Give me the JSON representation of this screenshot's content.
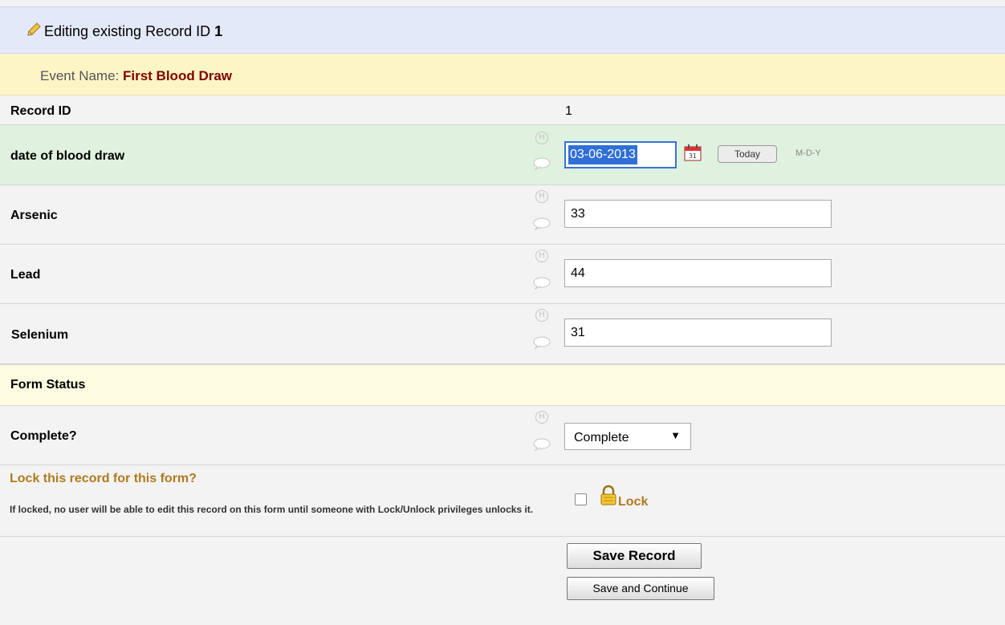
{
  "header": {
    "prefix": "Editing existing Record ID",
    "record_id": "1"
  },
  "event": {
    "label": "Event Name:",
    "value": "First Blood Draw"
  },
  "rows": {
    "record_id": {
      "label": "Record ID",
      "value": "1"
    },
    "blood_draw": {
      "label": "date of blood draw",
      "value": "03-06-2013",
      "today_label": "Today",
      "format": "M-D-Y"
    },
    "arsenic": {
      "label": "Arsenic",
      "value": "33"
    },
    "lead": {
      "label": "Lead",
      "value": "44"
    },
    "selenium": {
      "label": "Selenium",
      "value": "31"
    }
  },
  "form_status": {
    "heading": "Form Status"
  },
  "complete": {
    "label": "Complete?",
    "selected": "Complete"
  },
  "lock": {
    "title": "Lock this record for this form?",
    "note": "If locked, no user will be able to edit this record on this form until someone with Lock/Unlock privileges unlocks it.",
    "label": "Lock"
  },
  "buttons": {
    "save": "Save Record",
    "save_continue": "Save and Continue"
  },
  "history_icon_glyph": "H",
  "colors": {
    "header_bg": "#e3e9f9",
    "event_bg": "#fef5c6",
    "event_value": "#800000",
    "highlight_row": "#dff2df",
    "lock_text": "#b07a1d",
    "selection": "#2f6fd6"
  }
}
